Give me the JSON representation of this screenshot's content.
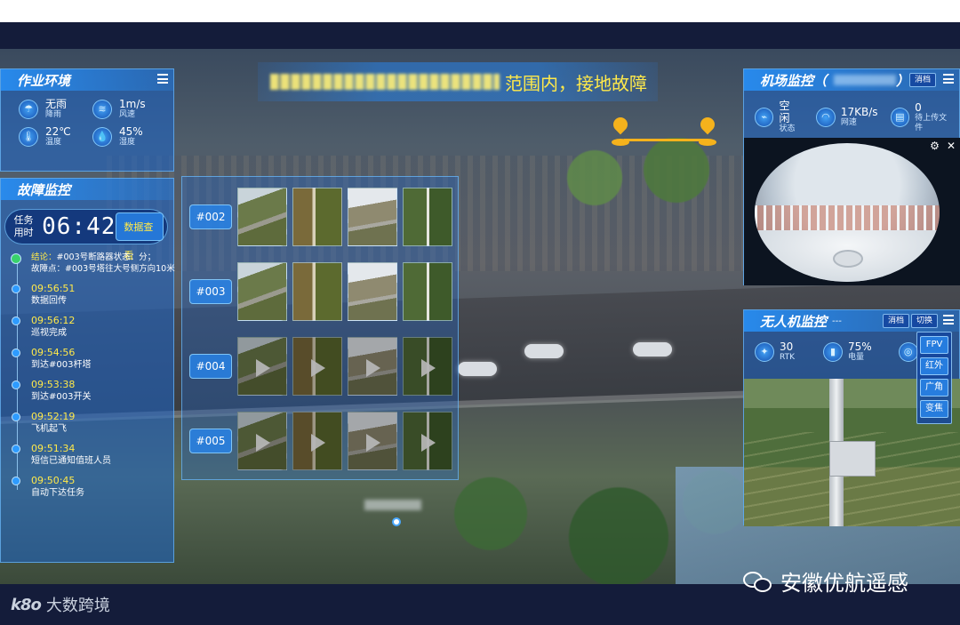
{
  "colors": {
    "panel_bg": "#1c64c8",
    "accent_yellow": "#ffe94a",
    "marker_orange": "#f5b21c",
    "frame_dark": "#141c3a",
    "status_green": "#39d26b"
  },
  "banner": {
    "text": "范围内，接地故障"
  },
  "env": {
    "title": "作业环境",
    "items": [
      {
        "value": "无雨",
        "label": "降雨",
        "icon": "rain-icon"
      },
      {
        "value": "1m/s",
        "label": "风速",
        "icon": "wind-icon"
      },
      {
        "value": "22℃",
        "label": "温度",
        "icon": "thermometer-icon"
      },
      {
        "value": "45%",
        "label": "湿度",
        "icon": "humidity-icon"
      }
    ]
  },
  "fault": {
    "title": "故障监控",
    "timer_label": "任务用时",
    "timer_value": "06:42",
    "data_button": "数据查看",
    "conclusion_key": "结论：",
    "conclusion_text": "#003号断路器状态：分；",
    "fault_point_key": "故障点：",
    "fault_point_text": "#003号塔往大号侧方向10米",
    "timeline": [
      {
        "time": "09:56:51",
        "desc": "数据回传"
      },
      {
        "time": "09:56:12",
        "desc": "巡视完成"
      },
      {
        "time": "09:54:56",
        "desc": "到达#003杆塔"
      },
      {
        "time": "09:53:38",
        "desc": "到达#003开关"
      },
      {
        "time": "09:52:19",
        "desc": "飞机起飞"
      },
      {
        "time": "09:51:34",
        "desc": "短信已通知值班人员"
      },
      {
        "time": "09:50:45",
        "desc": "自动下达任务"
      }
    ]
  },
  "gallery": {
    "rows": [
      {
        "tag": "#002",
        "kind": "photo"
      },
      {
        "tag": "#003",
        "kind": "photo"
      },
      {
        "tag": "#004",
        "kind": "video"
      },
      {
        "tag": "#005",
        "kind": "video"
      }
    ]
  },
  "airport": {
    "title": "机场监控（",
    "title_close": "）",
    "button": "消档",
    "stats": [
      {
        "value": "空闲",
        "label": "状态",
        "icon": "status-icon"
      },
      {
        "value": "17KB/s",
        "label": "网速",
        "icon": "wifi-icon"
      },
      {
        "value": "0",
        "label": "待上传文件",
        "icon": "file-icon"
      }
    ]
  },
  "drone": {
    "title": "无人机监控",
    "title_suffix": "---",
    "btn_clear": "消档",
    "btn_switch": "切换",
    "stats": [
      {
        "value": "30",
        "label": "RTK",
        "icon": "satellite-icon"
      },
      {
        "value": "75%",
        "label": "电量",
        "icon": "battery-icon"
      }
    ],
    "menu": [
      "FPV",
      "红外",
      "广角",
      "变焦"
    ]
  },
  "watermarks": {
    "left_logo": "k8o",
    "left_text": "大数跨境",
    "right_text": "安徽优航遥感"
  }
}
